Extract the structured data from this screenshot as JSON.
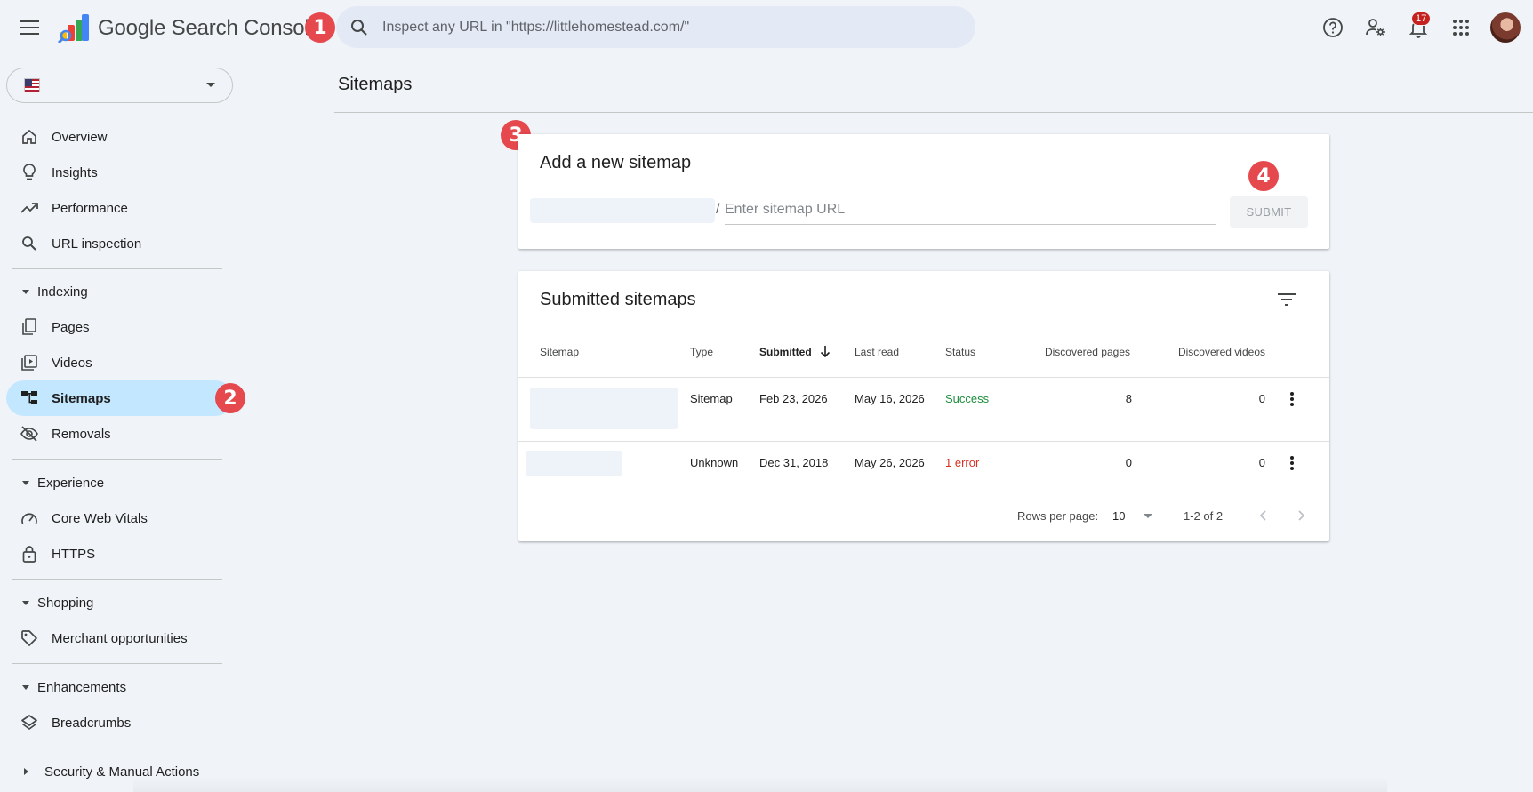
{
  "header": {
    "product_google": "Google",
    "product_name": "Search Console",
    "search_placeholder": "Inspect any URL in \"https://littlehomestead.com/\"",
    "notification_count": "17"
  },
  "annotations": [
    "1",
    "2",
    "3",
    "4"
  ],
  "sidebar": {
    "items": [
      {
        "label": "Overview",
        "icon": "home-icon"
      },
      {
        "label": "Insights",
        "icon": "lightbulb-icon"
      },
      {
        "label": "Performance",
        "icon": "trending-up-icon"
      },
      {
        "label": "URL inspection",
        "icon": "search-icon"
      }
    ],
    "sections": [
      {
        "label": "Indexing",
        "items": [
          "Pages",
          "Videos",
          "Sitemaps",
          "Removals"
        ]
      },
      {
        "label": "Experience",
        "items": [
          "Core Web Vitals",
          "HTTPS"
        ]
      },
      {
        "label": "Shopping",
        "items": [
          "Merchant opportunities"
        ]
      },
      {
        "label": "Enhancements",
        "items": [
          "Breadcrumbs"
        ]
      },
      {
        "label": "Security & Manual Actions",
        "items": []
      }
    ],
    "active": "Sitemaps"
  },
  "page": {
    "title": "Sitemaps"
  },
  "add_sitemap": {
    "title": "Add a new sitemap",
    "slash": "/",
    "input_placeholder": "Enter sitemap URL",
    "submit_label": "SUBMIT"
  },
  "submitted": {
    "title": "Submitted sitemaps",
    "columns": [
      "Sitemap",
      "Type",
      "Submitted",
      "Last read",
      "Status",
      "Discovered pages",
      "Discovered videos"
    ],
    "rows": [
      {
        "type": "Sitemap",
        "submitted": "Feb 23, 2026",
        "last_read": "May 16, 2026",
        "status": "Success",
        "pages": "8",
        "videos": "0"
      },
      {
        "type": "Unknown",
        "submitted": "Dec 31, 2018",
        "last_read": "May 26, 2026",
        "status": "1 error",
        "pages": "0",
        "videos": "0"
      }
    ],
    "rows_per_page_label": "Rows per page:",
    "rows_per_page": "10",
    "range": "1-2 of 2"
  },
  "colors": {
    "success": "#1e8e3e",
    "error": "#d93025",
    "active_nav": "#c2e7ff",
    "annotation": "#e5484d"
  }
}
